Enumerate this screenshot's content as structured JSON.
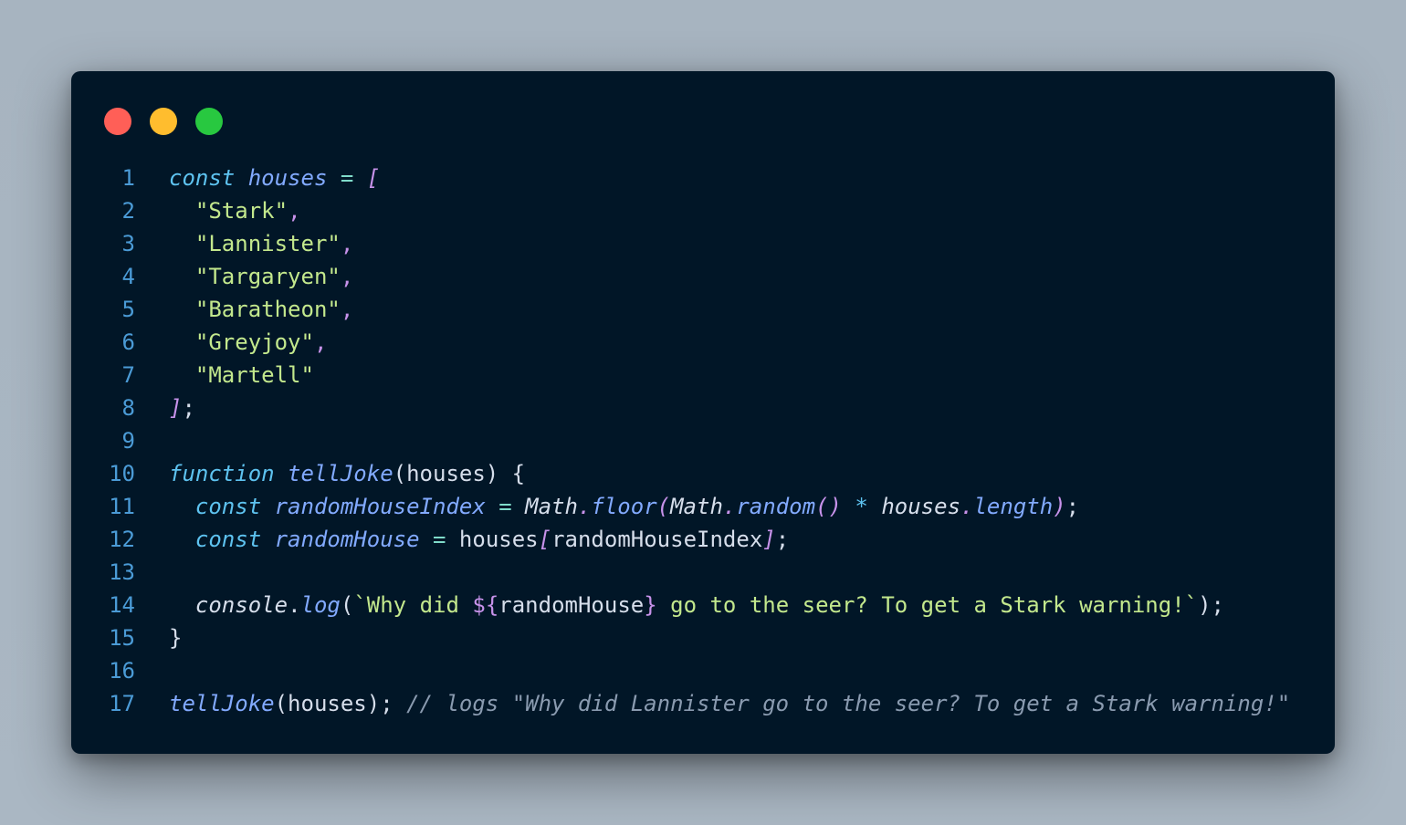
{
  "window": {
    "controls": [
      {
        "name": "close-dot",
        "color": "#ff5f57"
      },
      {
        "name": "minimize-dot",
        "color": "#ffbd2e"
      },
      {
        "name": "zoom-dot",
        "color": "#28c840"
      }
    ]
  },
  "theme": {
    "background": "#011627",
    "line_number": "#4b9bd6",
    "keyword": "#5ec3f0",
    "variable": "#82aaff",
    "string": "#c3e88d",
    "punctuation": "#c792ea",
    "plain": "#d6deeb",
    "operator": "#7fdbca",
    "comment": "#8a9bb0"
  },
  "lines": [
    {
      "n": "1",
      "tokens": [
        {
          "t": "const",
          "c": "keyword",
          "i": true
        },
        {
          "t": " ",
          "c": "plain"
        },
        {
          "t": "houses",
          "c": "variable",
          "i": true
        },
        {
          "t": " ",
          "c": "plain"
        },
        {
          "t": "=",
          "c": "operator"
        },
        {
          "t": " ",
          "c": "plain"
        },
        {
          "t": "[",
          "c": "punctuation",
          "i": true
        }
      ]
    },
    {
      "n": "2",
      "tokens": [
        {
          "t": "  ",
          "c": "plain"
        },
        {
          "t": "\"Stark\"",
          "c": "string"
        },
        {
          "t": ",",
          "c": "punctuation"
        }
      ]
    },
    {
      "n": "3",
      "tokens": [
        {
          "t": "  ",
          "c": "plain"
        },
        {
          "t": "\"Lannister\"",
          "c": "string"
        },
        {
          "t": ",",
          "c": "punctuation"
        }
      ]
    },
    {
      "n": "4",
      "tokens": [
        {
          "t": "  ",
          "c": "plain"
        },
        {
          "t": "\"Targaryen\"",
          "c": "string"
        },
        {
          "t": ",",
          "c": "punctuation"
        }
      ]
    },
    {
      "n": "5",
      "tokens": [
        {
          "t": "  ",
          "c": "plain"
        },
        {
          "t": "\"Baratheon\"",
          "c": "string"
        },
        {
          "t": ",",
          "c": "punctuation"
        }
      ]
    },
    {
      "n": "6",
      "tokens": [
        {
          "t": "  ",
          "c": "plain"
        },
        {
          "t": "\"Greyjoy\"",
          "c": "string"
        },
        {
          "t": ",",
          "c": "punctuation"
        }
      ]
    },
    {
      "n": "7",
      "tokens": [
        {
          "t": "  ",
          "c": "plain"
        },
        {
          "t": "\"Martell\"",
          "c": "string"
        }
      ]
    },
    {
      "n": "8",
      "tokens": [
        {
          "t": "]",
          "c": "punctuation",
          "i": true
        },
        {
          "t": ";",
          "c": "plain"
        }
      ]
    },
    {
      "n": "9",
      "tokens": []
    },
    {
      "n": "10",
      "tokens": [
        {
          "t": "function",
          "c": "keyword",
          "i": true
        },
        {
          "t": " ",
          "c": "plain"
        },
        {
          "t": "tellJoke",
          "c": "variable",
          "i": true
        },
        {
          "t": "(houses) {",
          "c": "plain"
        }
      ]
    },
    {
      "n": "11",
      "tokens": [
        {
          "t": "  ",
          "c": "plain"
        },
        {
          "t": "const",
          "c": "keyword",
          "i": true
        },
        {
          "t": " ",
          "c": "plain"
        },
        {
          "t": "randomHouseIndex",
          "c": "variable",
          "i": true
        },
        {
          "t": " ",
          "c": "plain"
        },
        {
          "t": "=",
          "c": "operator"
        },
        {
          "t": " ",
          "c": "plain"
        },
        {
          "t": "Math",
          "c": "plain",
          "i": true
        },
        {
          "t": ".",
          "c": "punctuation",
          "i": true
        },
        {
          "t": "floor",
          "c": "variable",
          "i": true
        },
        {
          "t": "(",
          "c": "punctuation",
          "i": true
        },
        {
          "t": "Math",
          "c": "plain",
          "i": true
        },
        {
          "t": ".",
          "c": "punctuation",
          "i": true
        },
        {
          "t": "random",
          "c": "variable",
          "i": true
        },
        {
          "t": "()",
          "c": "punctuation",
          "i": true
        },
        {
          "t": " ",
          "c": "plain"
        },
        {
          "t": "*",
          "c": "keyword",
          "i": true
        },
        {
          "t": " ",
          "c": "plain"
        },
        {
          "t": "houses",
          "c": "plain",
          "i": true
        },
        {
          "t": ".",
          "c": "punctuation",
          "i": true
        },
        {
          "t": "length",
          "c": "variable",
          "i": true
        },
        {
          "t": ")",
          "c": "punctuation",
          "i": true
        },
        {
          "t": ";",
          "c": "plain"
        }
      ]
    },
    {
      "n": "12",
      "tokens": [
        {
          "t": "  ",
          "c": "plain"
        },
        {
          "t": "const",
          "c": "keyword",
          "i": true
        },
        {
          "t": " ",
          "c": "plain"
        },
        {
          "t": "randomHouse",
          "c": "variable",
          "i": true
        },
        {
          "t": " ",
          "c": "plain"
        },
        {
          "t": "=",
          "c": "operator"
        },
        {
          "t": " houses",
          "c": "plain"
        },
        {
          "t": "[",
          "c": "punctuation",
          "i": true
        },
        {
          "t": "randomHouseIndex",
          "c": "plain"
        },
        {
          "t": "]",
          "c": "punctuation",
          "i": true
        },
        {
          "t": ";",
          "c": "plain"
        }
      ]
    },
    {
      "n": "13",
      "tokens": []
    },
    {
      "n": "14",
      "tokens": [
        {
          "t": "  ",
          "c": "plain"
        },
        {
          "t": "console",
          "c": "plain",
          "i": true
        },
        {
          "t": ".",
          "c": "plain"
        },
        {
          "t": "log",
          "c": "variable",
          "i": true
        },
        {
          "t": "(",
          "c": "plain"
        },
        {
          "t": "`Why did ",
          "c": "string"
        },
        {
          "t": "${",
          "c": "punctuation"
        },
        {
          "t": "randomHouse",
          "c": "plain"
        },
        {
          "t": "}",
          "c": "punctuation"
        },
        {
          "t": " go to the seer? To get a Stark warning!`",
          "c": "string"
        },
        {
          "t": ");",
          "c": "plain"
        }
      ]
    },
    {
      "n": "15",
      "tokens": [
        {
          "t": "}",
          "c": "plain"
        }
      ]
    },
    {
      "n": "16",
      "tokens": []
    },
    {
      "n": "17",
      "tokens": [
        {
          "t": "tellJoke",
          "c": "variable",
          "i": true
        },
        {
          "t": "(houses); ",
          "c": "plain"
        },
        {
          "t": "// logs \"Why did Lannister go to the seer? To get a Stark warning!\"",
          "c": "comment",
          "i": true
        }
      ]
    }
  ]
}
